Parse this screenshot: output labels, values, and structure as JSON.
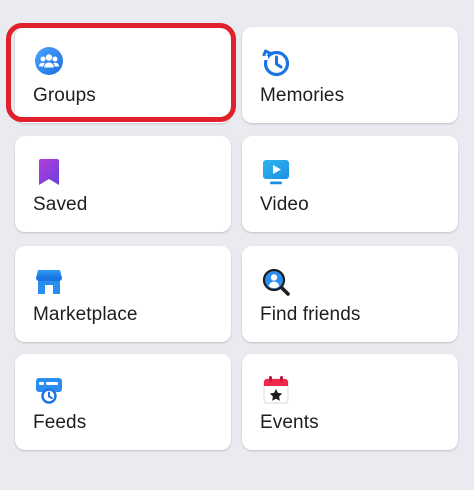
{
  "shortcuts": [
    {
      "label": "Groups",
      "icon": "groups-icon"
    },
    {
      "label": "Memories",
      "icon": "memories-clock-icon"
    },
    {
      "label": "Saved",
      "icon": "saved-bookmark-icon"
    },
    {
      "label": "Video",
      "icon": "video-play-icon"
    },
    {
      "label": "Marketplace",
      "icon": "marketplace-storefront-icon"
    },
    {
      "label": "Find friends",
      "icon": "find-friends-search-icon"
    },
    {
      "label": "Feeds",
      "icon": "feeds-clock-icon"
    },
    {
      "label": "Events",
      "icon": "events-calendar-star-icon"
    }
  ],
  "colors": {
    "background": "#e9ebf0",
    "tile": "#ffffff",
    "text": "#1c1e21",
    "highlight_border": "#e0202a",
    "accent_blue": "#1877f2"
  }
}
